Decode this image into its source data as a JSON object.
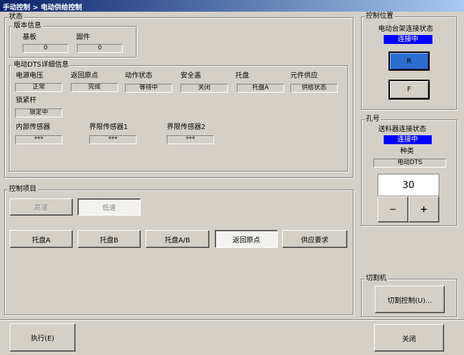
{
  "window": {
    "title": "手动控制 > 电动供给控制"
  },
  "status": {
    "legend": "状态",
    "version": {
      "legend": "版本信息",
      "board_label": "基板",
      "board_value": "0",
      "firmware_label": "固件",
      "firmware_value": "0"
    },
    "details": {
      "legend": "电动DTS详细信息",
      "power_label": "电源电压",
      "power_value": "正常",
      "return_label": "返回原点",
      "return_value": "完成",
      "action_label": "动作状态",
      "action_value": "等待中",
      "safety_label": "安全盖",
      "safety_value": "关闭",
      "tray_label": "托盘",
      "tray_value": "托盘A",
      "supply_label": "元件供应",
      "supply_value": "供给状态",
      "lock_label": "锁紧杆",
      "lock_value": "锁定中",
      "inner_sensor_label": "内部传感器",
      "inner_sensor_value": "***",
      "limit1_label": "界限传感器1",
      "limit1_value": "***",
      "limit2_label": "界限传感器2",
      "limit2_value": "***"
    }
  },
  "control_position": {
    "legend": "控制位置",
    "stand_label": "电动台架连接状态",
    "stand_status": "连接中",
    "r_label": "R",
    "f_label": "F"
  },
  "hole": {
    "legend": "孔号",
    "feeder_label": "送料器连接状态",
    "feeder_status": "连接中",
    "type_label": "种类",
    "type_value": "电动DTS",
    "number_value": "30",
    "minus_label": "−",
    "plus_label": "+"
  },
  "control_items": {
    "legend": "控制项目",
    "high_speed": "高速",
    "low_speed": "低速",
    "tray_a": "托盘A",
    "tray_b": "托盘B",
    "tray_ab": "托盘A/B",
    "return_origin": "返回原点",
    "supply_request": "供应要求"
  },
  "cut": {
    "legend": "切割机",
    "cut_control": "切割控制(U)..."
  },
  "footer": {
    "execute": "执行(E)",
    "close": "关闭"
  },
  "colors": {
    "status_blue": "#0000ff",
    "r_button": "#2b6ccf"
  }
}
